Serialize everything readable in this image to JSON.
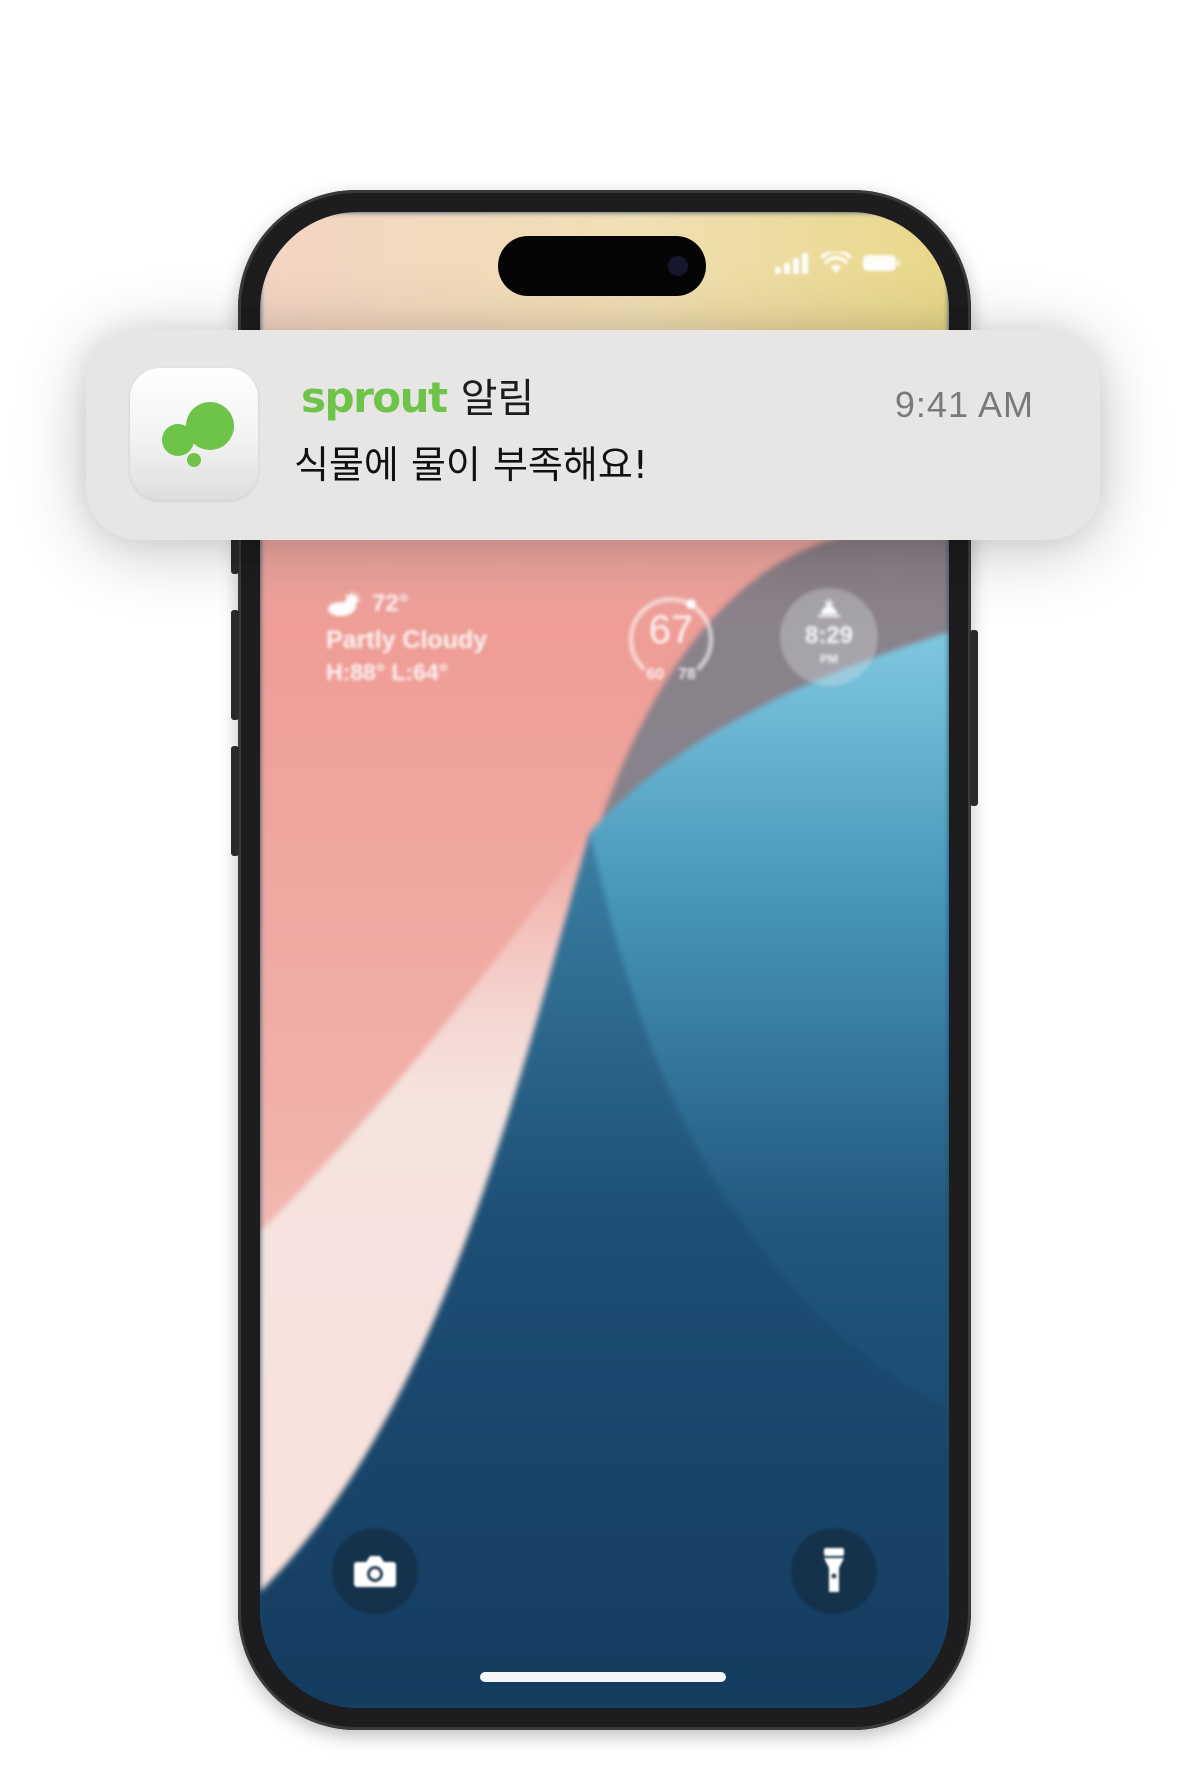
{
  "notification": {
    "app_name": "sprout",
    "title_suffix": "알림",
    "message": "식물에 물이 부족해요!",
    "time": "9:41 AM",
    "app_icon": "sprout-bubbles-icon",
    "brand_color": "#6ec349",
    "background_color": "#e8e5e5"
  },
  "lock_screen": {
    "status_icons": [
      "cellular-signal-icon",
      "wifi-icon",
      "battery-icon"
    ],
    "weather": {
      "temperature": "72°",
      "condition": "Partly Cloudy",
      "high_low": "H:88° L:64°",
      "icon": "partly-cloudy-icon"
    },
    "temperature_gauge": {
      "current": "67",
      "low": "60",
      "high": "78"
    },
    "sunset_widget": {
      "time": "8:29",
      "period": "PM",
      "icon": "sunset-icon"
    },
    "quick_actions": {
      "left": "camera-icon",
      "right": "flashlight-icon"
    },
    "colors": {
      "coral": "#ef9c94",
      "navy": "#164265",
      "teal": "#4b9bbd",
      "cream": "#f4e7d8"
    }
  }
}
